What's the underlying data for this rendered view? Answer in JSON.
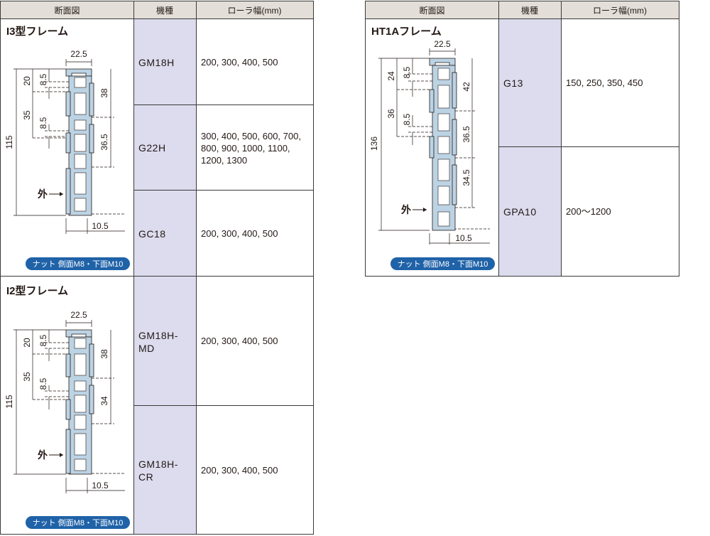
{
  "header": {
    "section": "断面図",
    "model": "機種",
    "width": "ローラ幅(mm)"
  },
  "i3": {
    "title": "I3型フレーム",
    "nut": "ナット 側面M8・下面M10",
    "dims": {
      "top": "22.5",
      "a": "20",
      "b": "8.5",
      "c": "38",
      "d": "35",
      "e": "8.5",
      "f": "36.5",
      "total": "115",
      "bottom": "10.5",
      "outer": "外"
    }
  },
  "i2": {
    "title": "I2型フレーム",
    "nut": "ナット 側面M8・下面M10",
    "dims": {
      "top": "22.5",
      "a": "20",
      "b": "8.5",
      "c": "38",
      "d": "35",
      "e": "8.5",
      "f": "34",
      "total": "115",
      "bottom": "10.5",
      "outer": "外"
    }
  },
  "ht1a": {
    "title": "HT1Aフレーム",
    "nut": "ナット 側面M8・下面M10",
    "dims": {
      "top": "22.5",
      "a": "24",
      "b": "8.5",
      "c": "42",
      "d": "36",
      "e": "8.5",
      "f": "36.5",
      "g": "34.5",
      "total": "136",
      "bottom": "10.5",
      "outer": "外"
    }
  },
  "rows_left": [
    {
      "model": "GM18H",
      "widths": "200, 300, 400, 500"
    },
    {
      "model": "G22H",
      "widths": "300, 400, 500, 600, 700, 800, 900, 1000, 1100, 1200, 1300"
    },
    {
      "model": "GC18",
      "widths": "200, 300, 400, 500"
    },
    {
      "model": "GM18H-MD",
      "widths": "200, 300, 400, 500"
    },
    {
      "model": "GM18H-CR",
      "widths": "200, 300, 400, 500"
    }
  ],
  "rows_right": [
    {
      "model": "G13",
      "widths": "150, 250, 350, 450"
    },
    {
      "model": "GPA10",
      "widths": "200～1200"
    }
  ]
}
